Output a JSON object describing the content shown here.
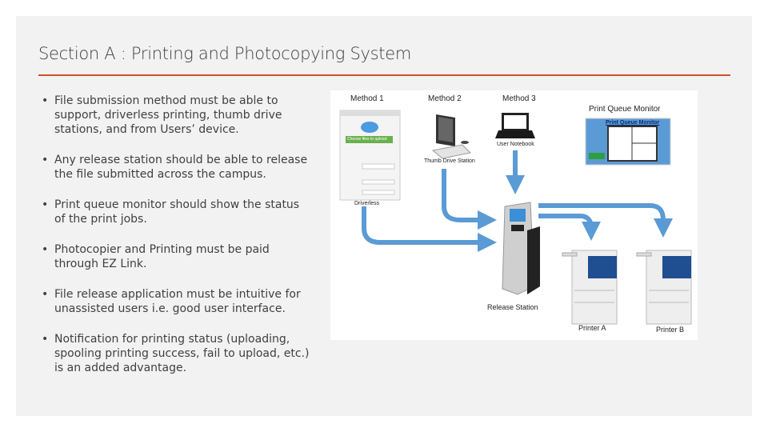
{
  "slide": {
    "title": "Section A : Printing and Photocopying System",
    "bullet_glyph": "•",
    "bullets": [
      "File submission method must be able to support, driverless printing, thumb drive stations, and from Users’ device.",
      "Any release station should be able to release the file submitted across the campus.",
      "Print queue monitor should show the status of the print jobs.",
      "Photocopier and Printing must be paid through EZ Link.",
      "File release application must be intuitive for unassisted users i.e. good user interface.",
      "Notification for printing status (uploading, spooling printing success, fail to upload, etc.) is an added advantage."
    ]
  },
  "diagram": {
    "method1": "Method 1",
    "method2": "Method 2",
    "method3": "Method 3",
    "print_queue_monitor": "Print Queue Monitor",
    "pqm_screen_title": "Print Queue Monitor",
    "upload_button": "Choose files to upload",
    "driverless": "Driverless",
    "thumb_drive_station": "Thumb Drive Station",
    "user_notebook": "User Notebook",
    "release_station": "Release Station",
    "printer_a": "Printer A",
    "printer_b": "Printer B",
    "arrow_color": "#5b9bd5",
    "accent_color": "#d0502c"
  }
}
